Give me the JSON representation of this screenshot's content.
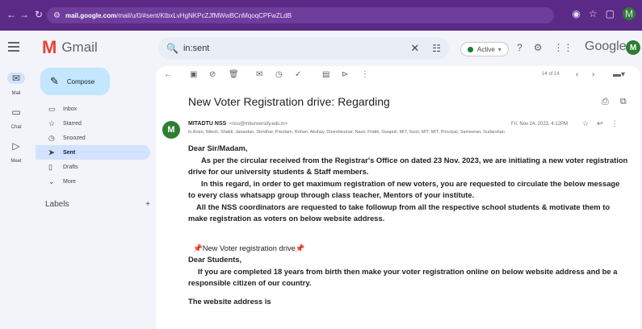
{
  "browser": {
    "url_host": "mail.google.com",
    "url_path": "/mail/u/0/#sent/KtbxLvHgNKPcZJfMWwBCnMqoqCPFwZLdB",
    "profile_initial": "M"
  },
  "gmail": {
    "logo_text": "Gmail",
    "search_value": "in:sent",
    "status": "Active",
    "brand": "Google",
    "account_initial": "M"
  },
  "rail": [
    {
      "label": "Mail",
      "icon": "mail-icon"
    },
    {
      "label": "Chat",
      "icon": "chat-icon"
    },
    {
      "label": "Meet",
      "icon": "meet-icon"
    }
  ],
  "sidebar": {
    "compose": "Compose",
    "items": [
      {
        "label": "Inbox",
        "icon": "inbox-icon"
      },
      {
        "label": "Starred",
        "icon": "star-icon"
      },
      {
        "label": "Snoozed",
        "icon": "clock-icon"
      },
      {
        "label": "Sent",
        "icon": "send-icon"
      },
      {
        "label": "Drafts",
        "icon": "draft-icon"
      },
      {
        "label": "More",
        "icon": "chevron-down-icon"
      }
    ],
    "labels_heading": "Labels",
    "add": "+"
  },
  "toolbar": {
    "pager": "14 of 14"
  },
  "email": {
    "subject": "New Voter Registration drive: Regarding",
    "sender_name": "MITADTU NSS",
    "sender_email": "<nss@mitunversity.edu.in>",
    "to_line": "to Anan, Nilesh, Shakti, Janardan, Shridhar, Preetam, Rohan, Akshay, Dineshkumar, Nasir, Pratik, Swapnil, MIT, Sunil, MIT, MIT, Principal, Sameeran, Sudarshan",
    "date": "Fri, Nov 24, 2023, 4:12PM",
    "greeting": "Dear Sir/Madam,",
    "para1": "As per the circular received from the Registrar's Office on dated 23 Nov. 2023, we are initiating a new voter registration drive for our university students & Staff members.",
    "para2": "In this regard, in order to get  maximum registration of new voters, you are requested to circulate the below message to every class whatsapp group through class teacher, Mentors of your institute.",
    "para3": "All the NSS coordinators are requested to take followup from all the respective  school students & motivate them to make registration as voters on below website address.",
    "drive_title": "New Voter registration drive",
    "students_greeting": "Dear Students,",
    "para4": "If you are completed 18 years from birth then make your voter registration online on below website address and be a responsible citizen of our country.",
    "website_heading": "The website address is"
  }
}
